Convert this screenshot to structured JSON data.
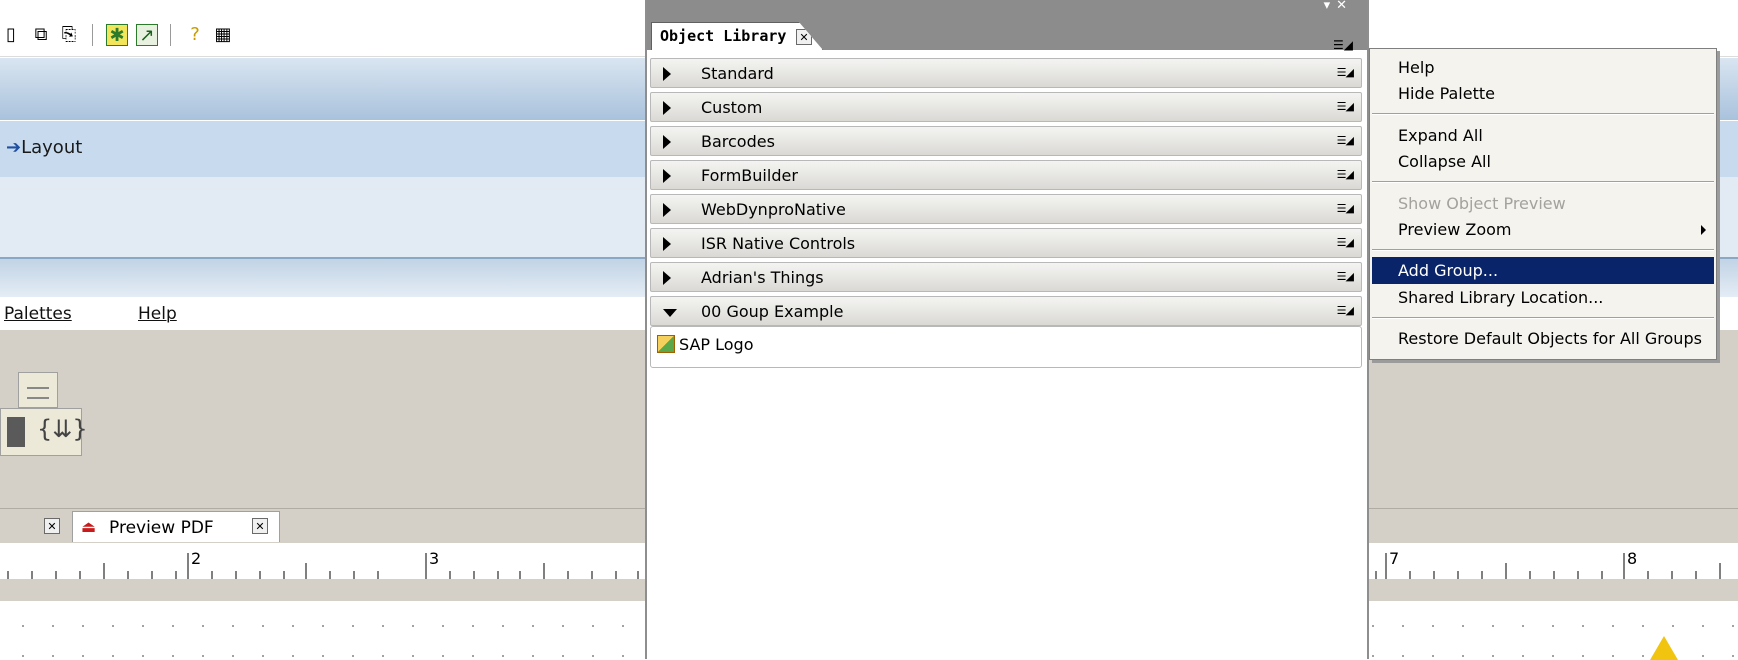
{
  "menubar": {
    "palettes": "Palettes",
    "help": "Help"
  },
  "band": {
    "layout_label": "Layout"
  },
  "tabs": {
    "preview_pdf": "Preview PDF"
  },
  "ruler": {
    "labels": [
      "2",
      "3",
      "7",
      "8"
    ]
  },
  "palette": {
    "title": "Object Library",
    "groups": [
      {
        "name": "Standard",
        "expanded": false
      },
      {
        "name": "Custom",
        "expanded": false
      },
      {
        "name": "Barcodes",
        "expanded": false
      },
      {
        "name": "FormBuilder",
        "expanded": false
      },
      {
        "name": "WebDynproNative",
        "expanded": false
      },
      {
        "name": "ISR Native Controls",
        "expanded": false
      },
      {
        "name": "Adrian's Things",
        "expanded": false
      },
      {
        "name": "00 Goup Example",
        "expanded": true
      }
    ],
    "expanded_items": [
      {
        "name": "SAP Logo",
        "icon": "sap-logo-icon"
      }
    ]
  },
  "context_menu": {
    "items": [
      {
        "label": "Help"
      },
      {
        "label": "Hide Palette"
      },
      {
        "label": "Expand All"
      },
      {
        "label": "Collapse All"
      },
      {
        "label": "Show Object Preview",
        "disabled": true
      },
      {
        "label": "Preview Zoom",
        "submenu": true
      },
      {
        "label": "Add Group...",
        "selected": true
      },
      {
        "label": "Shared Library Location..."
      },
      {
        "label": "Restore Default Objects for All Groups"
      }
    ]
  },
  "colors": {
    "menu_highlight": "#0a246a",
    "band_blue": "#c8dbee",
    "panel_grey": "#d4d0c8"
  }
}
